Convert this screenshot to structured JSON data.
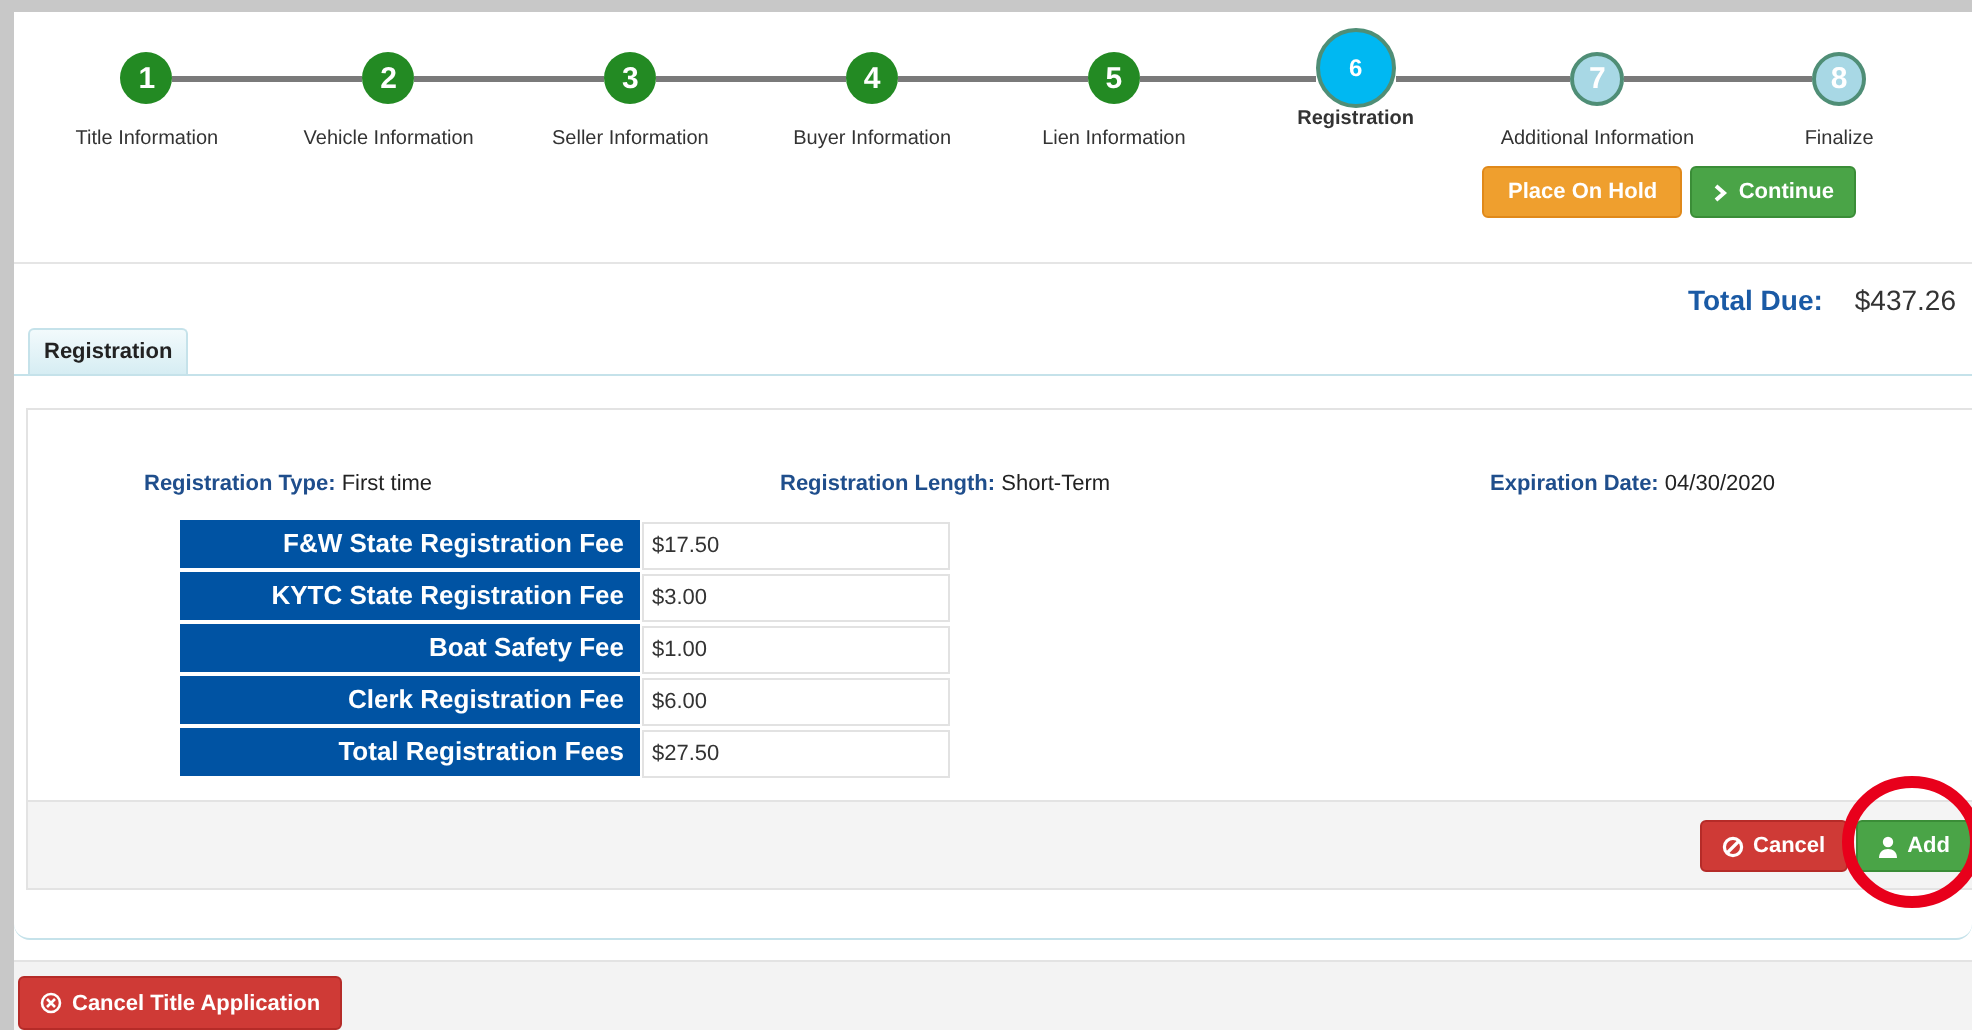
{
  "steps": [
    {
      "number": "1",
      "label": "Title Information",
      "completed": true,
      "selected": false
    },
    {
      "number": "2",
      "label": "Vehicle Information",
      "completed": true,
      "selected": false
    },
    {
      "number": "3",
      "label": "Seller Information",
      "completed": true,
      "selected": false
    },
    {
      "number": "4",
      "label": "Buyer Information",
      "completed": true,
      "selected": false
    },
    {
      "number": "5",
      "label": "Lien Information",
      "completed": true,
      "selected": false
    },
    {
      "number": "6",
      "label": "Registration",
      "completed": false,
      "selected": true
    },
    {
      "number": "7",
      "label": "Additional Information",
      "completed": false,
      "selected": false
    },
    {
      "number": "8",
      "label": "Finalize",
      "completed": false,
      "selected": false
    }
  ],
  "step_buttons": {
    "hold": "Place On Hold",
    "continue": "Continue"
  },
  "total_due": {
    "label": "Total Due:",
    "value": "$437.26"
  },
  "tab": {
    "label": "Registration",
    "selected": true
  },
  "summary": [
    {
      "label": "Registration Type:",
      "value": "First time"
    },
    {
      "label": "Registration Length:",
      "value": "Short-Term"
    },
    {
      "label": "Expiration Date:",
      "value": "04/30/2020"
    }
  ],
  "fees": [
    {
      "label": "F&W State Registration Fee",
      "value": "$17.50"
    },
    {
      "label": "KYTC State Registration Fee",
      "value": "$3.00"
    },
    {
      "label": "Boat Safety Fee",
      "value": "$1.00"
    },
    {
      "label": "Clerk Registration Fee",
      "value": "$6.00"
    },
    {
      "label": "Total Registration Fees",
      "value": "$27.50"
    }
  ],
  "form_buttons": {
    "cancel": "Cancel",
    "add": "Add"
  },
  "footer_button": "Cancel Title Application"
}
